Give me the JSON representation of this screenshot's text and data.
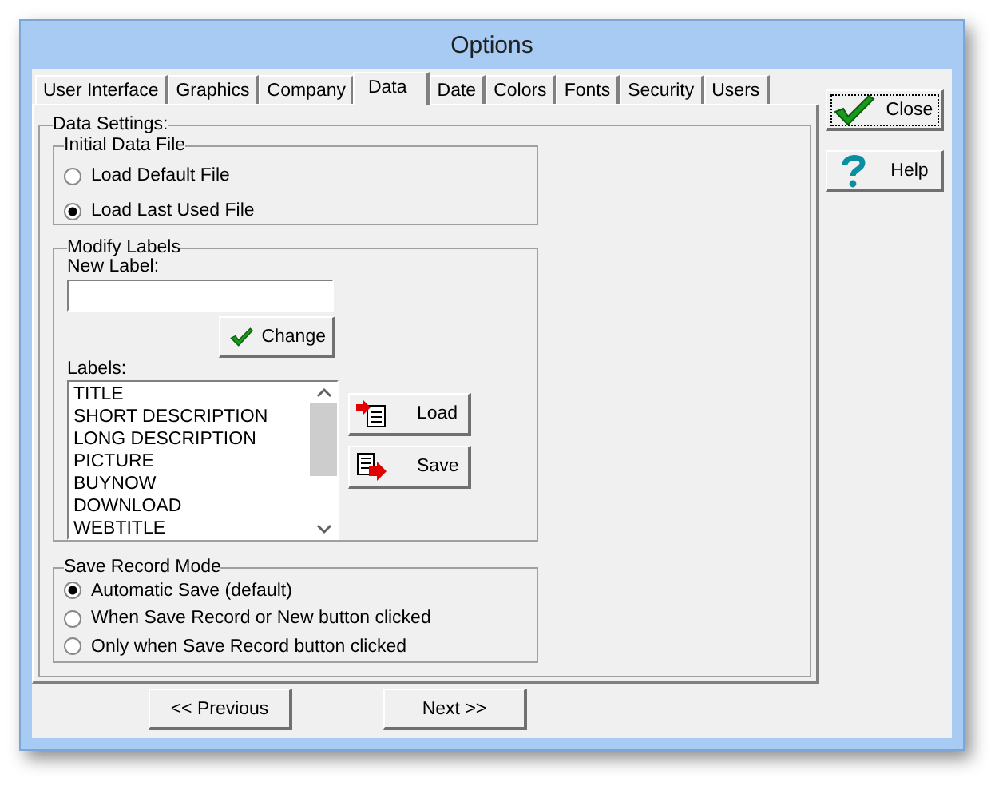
{
  "window": {
    "title": "Options"
  },
  "tabs": [
    {
      "label": "User Interface",
      "selected": false
    },
    {
      "label": "Graphics",
      "selected": false
    },
    {
      "label": "Company",
      "selected": false
    },
    {
      "label": "Data",
      "selected": true
    },
    {
      "label": "Date",
      "selected": false
    },
    {
      "label": "Colors",
      "selected": false
    },
    {
      "label": "Fonts",
      "selected": false
    },
    {
      "label": "Security",
      "selected": false
    },
    {
      "label": "Users",
      "selected": false
    }
  ],
  "data_settings": {
    "title": "Data Settings:",
    "initial_data_file": {
      "title": "Initial Data File",
      "options": [
        {
          "label": "Load Default File",
          "selected": false
        },
        {
          "label": "Load Last Used File",
          "selected": true
        }
      ]
    },
    "modify_labels": {
      "title": "Modify Labels",
      "new_label_caption": "New Label:",
      "change_button": "Change",
      "labels_caption": "Labels:",
      "labels": [
        "TITLE",
        "SHORT DESCRIPTION",
        "LONG DESCRIPTION",
        "PICTURE",
        "BUYNOW",
        "DOWNLOAD",
        "WEBTITLE"
      ],
      "load_button": "Load",
      "save_button": "Save"
    },
    "save_record_mode": {
      "title": "Save Record Mode",
      "options": [
        {
          "label": "Automatic Save (default)",
          "selected": true
        },
        {
          "label": "When Save Record or New button clicked",
          "selected": false
        },
        {
          "label": "Only when Save Record button clicked",
          "selected": false
        }
      ]
    }
  },
  "side_buttons": [
    {
      "label": "Close",
      "kind": "check",
      "focused": true
    },
    {
      "label": "Help",
      "kind": "question",
      "focused": false
    }
  ],
  "nav_buttons": [
    "<< Previous",
    "Next >>"
  ]
}
